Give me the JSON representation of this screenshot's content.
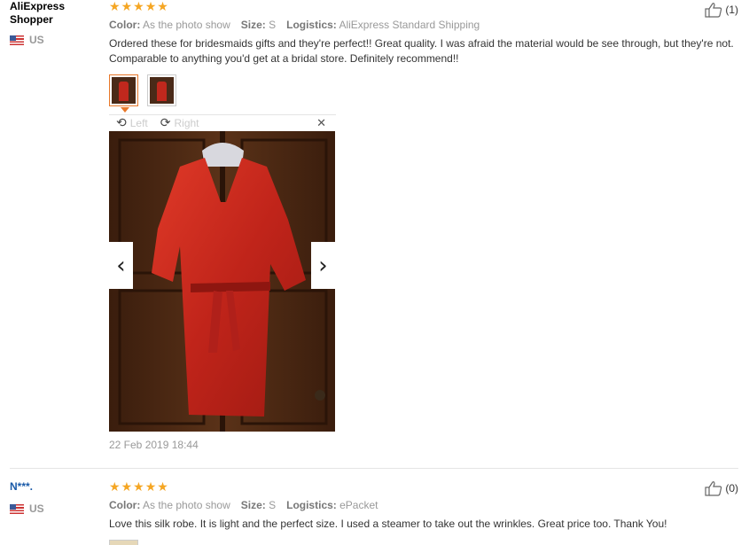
{
  "reviews": [
    {
      "user": "AliExpress Shopper",
      "country": "US",
      "rating": 5,
      "color_label": "Color:",
      "color_value": "As the photo show",
      "size_label": "Size:",
      "size_value": "S",
      "logistics_label": "Logistics:",
      "logistics_value": "AliExpress Standard Shipping",
      "text": "Ordered these for bridesmaids gifts and they're perfect!! Great quality. I was afraid the material would be see through, but they're not. Comparable to anything you'd get at a bridal store. Definitely recommend!!",
      "helpful_count": "(1)",
      "date": "22 Feb 2019 18:44",
      "viewer": {
        "left_label": "Left",
        "right_label": "Right"
      }
    },
    {
      "user": "N***.",
      "country": "US",
      "rating": 5,
      "color_label": "Color:",
      "color_value": "As the photo show",
      "size_label": "Size:",
      "size_value": "S",
      "logistics_label": "Logistics:",
      "logistics_value": "ePacket",
      "text": "Love this silk robe. It is light and the perfect size. I used a steamer to take out the wrinkles. Great price too. Thank You!",
      "helpful_count": "(0)"
    }
  ],
  "icons": {
    "star": "star-icon",
    "thumb_up": "thumb-up-icon",
    "rotate_left": "rotate-left-icon",
    "rotate_right": "rotate-right-icon",
    "close": "close-icon",
    "prev": "chevron-left-icon",
    "next": "chevron-right-icon",
    "flag": "us-flag-icon"
  },
  "colors": {
    "star": "#f5a623",
    "active_thumb": "#e8782a",
    "username_blue": "#1a5aa8"
  }
}
